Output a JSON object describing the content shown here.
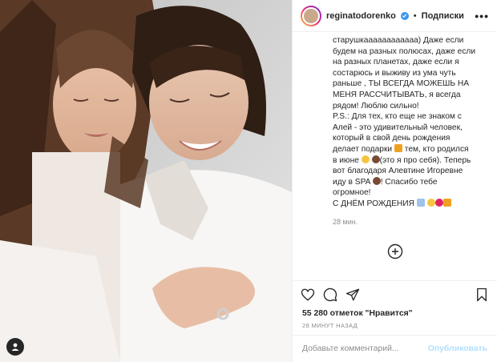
{
  "header": {
    "username": "reginatodorenko",
    "separator": "•",
    "follow_label": "Подписки",
    "more_label": "•••"
  },
  "caption": {
    "lines": [
      "старушкаааааааааааа) Даже если",
      "будем на разных полюсах, даже если",
      "на разных планетах, даже если я",
      "состарюсь и выживу из ума чуть",
      "раньше , ТЫ ВСЕГДА МОЖЕШЬ НА",
      "МЕНЯ РАССЧИТЫВАТЬ, я всегда",
      "рядом! Люблю сильно!",
      "P.S.: Для тех, кто еще не знаком с",
      "Алей - это удивительный человек,",
      "который в свой день рождения",
      "делает подарки",
      " тем, кто родился",
      "в июне",
      "(это я про себя). Теперь",
      "вот благодаря Алевтине Игоревне",
      "иду в SPA",
      "! Спасибо тебе",
      "огромное!",
      "С ДНЁМ РОЖДЕНИЯ"
    ],
    "time": "28 мин."
  },
  "stats": {
    "likes": "55 280 отметок \"Нравится\"",
    "ago": "28 МИНУТ НАЗАД"
  },
  "comment": {
    "placeholder": "Добавьте комментарий...",
    "publish_label": "Опубликовать"
  },
  "colors": {
    "link_blue": "#3897f0",
    "publish_disabled": "#b2dffc",
    "muted": "#8e8e8e",
    "text": "#262626"
  },
  "icons": [
    "user-tag-icon",
    "verified-icon",
    "heart-icon",
    "comment-icon",
    "share-icon",
    "save-icon",
    "add-circle-icon",
    "gift-icon",
    "smile-emoji-icon",
    "heart-emoji-icon"
  ]
}
